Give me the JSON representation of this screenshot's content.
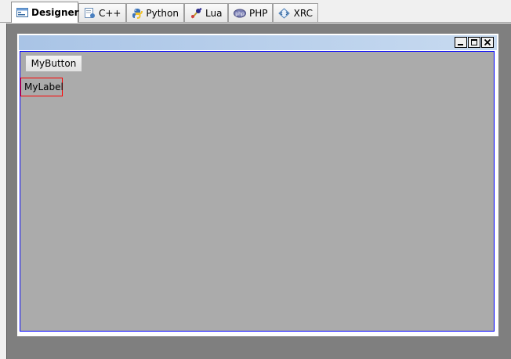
{
  "tabs": [
    {
      "label": "Designer",
      "icon": "designer-icon",
      "active": true
    },
    {
      "label": "C++",
      "icon": "cpp-icon"
    },
    {
      "label": "Python",
      "icon": "python-icon"
    },
    {
      "label": "Lua",
      "icon": "lua-icon"
    },
    {
      "label": "PHP",
      "icon": "php-icon"
    },
    {
      "label": "XRC",
      "icon": "xrc-icon"
    }
  ],
  "frame": {
    "controls": [
      "minimize",
      "maximize",
      "close"
    ]
  },
  "widgets": {
    "button_label": "MyButton",
    "label_text": "MyLabel"
  },
  "colors": {
    "canvas": "#7f7f7f",
    "client": "#ababab",
    "titlebar": "#a9c4e6",
    "selection_border": "#0000ff",
    "label_border": "#ff0000"
  }
}
